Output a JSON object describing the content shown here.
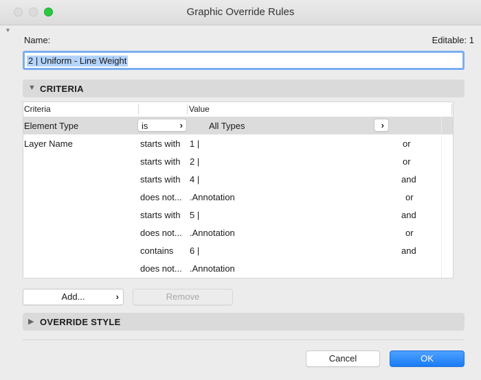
{
  "window": {
    "title": "Graphic Override Rules"
  },
  "form": {
    "name_label": "Name:",
    "editable_label": "Editable: 1",
    "name_value": "2 | Uniform - Line Weight"
  },
  "criteria_section": {
    "label": "CRITERIA",
    "columns": [
      "Criteria",
      "Value"
    ],
    "rows": [
      {
        "criteria": "Element Type",
        "operator": "is",
        "value": "All Types",
        "logic": ""
      },
      {
        "criteria": "Layer Name",
        "operator": "starts with",
        "value": "1 |",
        "logic": "or"
      },
      {
        "criteria": "",
        "operator": "starts with",
        "value": "2 |",
        "logic": "or"
      },
      {
        "criteria": "",
        "operator": "starts with",
        "value": "4 |",
        "logic": "and"
      },
      {
        "criteria": "",
        "operator": "does not...",
        "value": ".Annotation",
        "logic": "or"
      },
      {
        "criteria": "",
        "operator": "starts with",
        "value": "5 |",
        "logic": "and"
      },
      {
        "criteria": "",
        "operator": "does not...",
        "value": ".Annotation",
        "logic": "or"
      },
      {
        "criteria": "",
        "operator": "contains",
        "value": "6 |",
        "logic": "and"
      },
      {
        "criteria": "",
        "operator": "does not...",
        "value": ".Annotation",
        "logic": ""
      }
    ],
    "add_label": "Add...",
    "remove_label": "Remove"
  },
  "override_section": {
    "label": "OVERRIDE STYLE"
  },
  "footer": {
    "cancel_label": "Cancel",
    "ok_label": "OK"
  }
}
